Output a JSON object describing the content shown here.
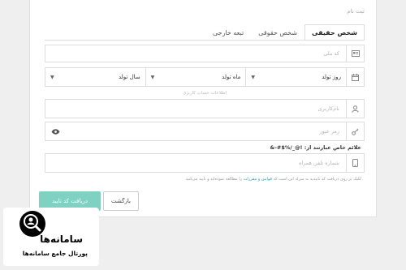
{
  "form": {
    "title": "ثبت نام",
    "tabs": [
      {
        "label": "شخص حقیقی"
      },
      {
        "label": "شخص حقوقی"
      },
      {
        "label": "تبعه خارجی"
      }
    ],
    "national_code_placeholder": "کد ملی",
    "birth": {
      "day": "روز تولد",
      "month": "ماه تولد",
      "year": "سال تولد"
    },
    "section_label": "اطلاعات حساب کاربری",
    "username_placeholder": "نام‌کاربری",
    "password_placeholder": "رمز عبور",
    "special_chars_hint": "علائم خاص عبارتند از: !@_/%$#-&",
    "phone_placeholder": "شماره تلفن همراه",
    "terms": {
      "before": "کلیک بر روی دریافت کد تاییدیه به منزله این است که",
      "link": "قوانین و مقررات",
      "after": "را مطالعه نموده‌اید و تایید می‌کنید"
    },
    "confirm_button": "دریافت کد تایید",
    "back_button": "بازگشت"
  },
  "watermark": {
    "name": "سامانه‌ها",
    "subtitle": "پورتال جامع سامانه‌ها"
  }
}
